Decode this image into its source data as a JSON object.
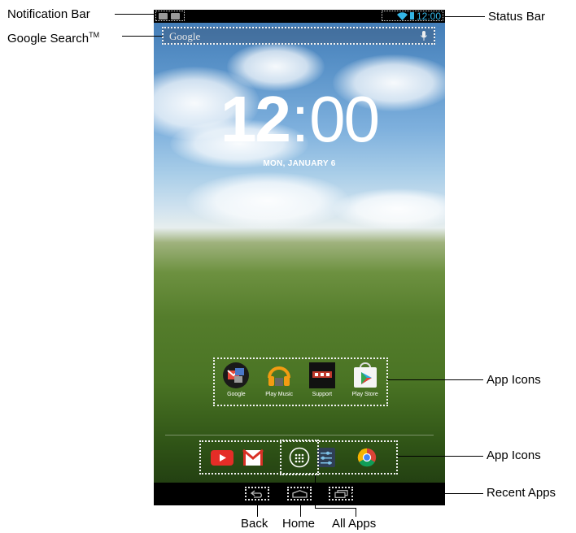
{
  "callouts": {
    "notification_bar": "Notification Bar",
    "google_search": "Google Search",
    "google_search_tm": "TM",
    "status_bar": "Status Bar",
    "app_icons_top": "App Icons",
    "app_icons_dock": "App Icons",
    "recent_apps": "Recent Apps",
    "back": "Back",
    "home": "Home",
    "all_apps": "All Apps"
  },
  "status_bar": {
    "time": "12:00",
    "accent_color": "#33b5e5",
    "icons": [
      "wifi-icon",
      "battery-icon"
    ],
    "notifications": [
      "image-notification-icon",
      "email-notification-icon"
    ]
  },
  "search": {
    "placeholder": "Google",
    "icon": "mic-icon"
  },
  "clock": {
    "hour": "12",
    "separator": ":",
    "minutes": "00",
    "date": "MON, JANUARY 6"
  },
  "apps": [
    {
      "label": "Google",
      "icon": "google-folder-icon"
    },
    {
      "label": "Play Music",
      "icon": "headphones-icon"
    },
    {
      "label": "Support",
      "icon": "rca-icon"
    },
    {
      "label": "Play Store",
      "icon": "play-store-icon"
    }
  ],
  "dock": [
    {
      "icon": "youtube-icon"
    },
    {
      "icon": "gmail-icon"
    },
    {
      "icon": "all-apps-icon"
    },
    {
      "icon": "settings-icon"
    },
    {
      "icon": "chrome-icon"
    }
  ],
  "nav": [
    {
      "icon": "back-icon"
    },
    {
      "icon": "home-icon"
    },
    {
      "icon": "recent-apps-icon"
    }
  ]
}
